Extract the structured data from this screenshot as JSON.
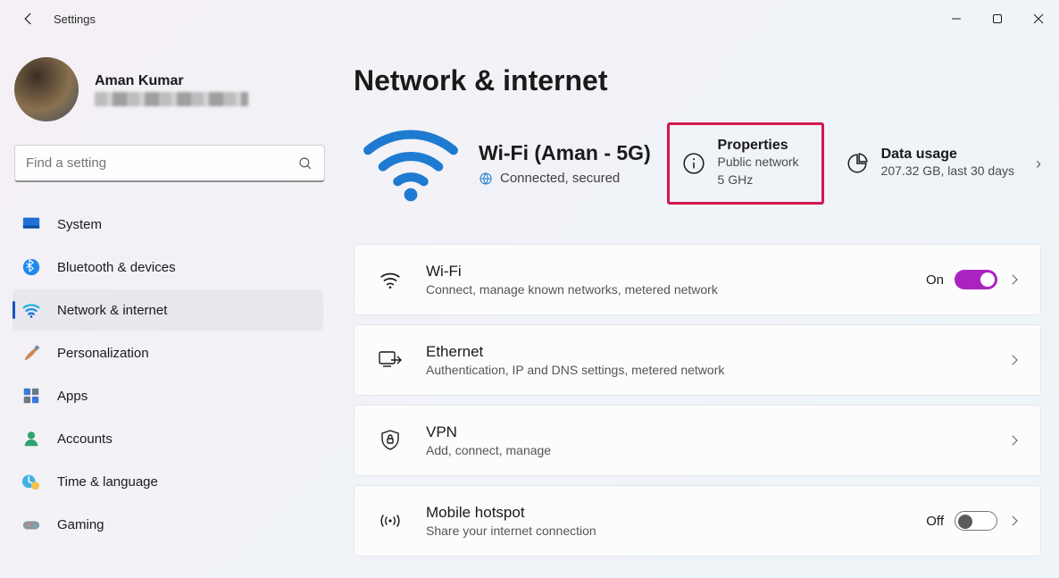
{
  "window": {
    "title": "Settings"
  },
  "profile": {
    "name": "Aman Kumar"
  },
  "search": {
    "placeholder": "Find a setting"
  },
  "sidebar": {
    "items": [
      {
        "label": "System"
      },
      {
        "label": "Bluetooth & devices"
      },
      {
        "label": "Network & internet"
      },
      {
        "label": "Personalization"
      },
      {
        "label": "Apps"
      },
      {
        "label": "Accounts"
      },
      {
        "label": "Time & language"
      },
      {
        "label": "Gaming"
      }
    ],
    "active_index": 2
  },
  "page": {
    "title": "Network & internet"
  },
  "hero": {
    "ssid": "Wi-Fi (Aman - 5G)",
    "status": "Connected, secured",
    "properties": {
      "title": "Properties",
      "sub1": "Public network",
      "sub2": "5 GHz"
    },
    "usage": {
      "title": "Data usage",
      "sub": "207.32 GB, last 30 days"
    }
  },
  "rows": [
    {
      "title": "Wi-Fi",
      "sub": "Connect, manage known networks, metered network",
      "state": "On",
      "toggle": "on"
    },
    {
      "title": "Ethernet",
      "sub": "Authentication, IP and DNS settings, metered network"
    },
    {
      "title": "VPN",
      "sub": "Add, connect, manage"
    },
    {
      "title": "Mobile hotspot",
      "sub": "Share your internet connection",
      "state": "Off",
      "toggle": "off"
    }
  ]
}
